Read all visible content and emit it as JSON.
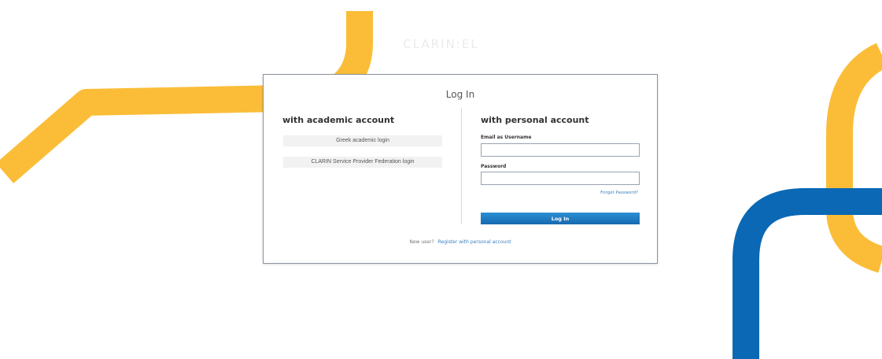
{
  "brand": "CLARIN:EL",
  "login": {
    "title": "Log In",
    "academic": {
      "heading": "with academic account",
      "greek_button": "Greek academic login",
      "clarin_button": "CLARIN Service Provider Federation login"
    },
    "personal": {
      "heading": "with personal account",
      "username_label": "Email as Username",
      "username_value": "",
      "password_label": "Password",
      "password_value": "",
      "forgot_link": "Forgot Password?",
      "submit_label": "Log In"
    },
    "footer": {
      "prompt": "New user?",
      "register_link": "Register with personal account"
    }
  },
  "colors": {
    "yellow_stripe": "#fbbd38",
    "blue_stripe": "#0a68b4",
    "button_blue": "#1c78c0",
    "link_blue": "#3a7fbf",
    "card_border": "#8a93a0"
  }
}
